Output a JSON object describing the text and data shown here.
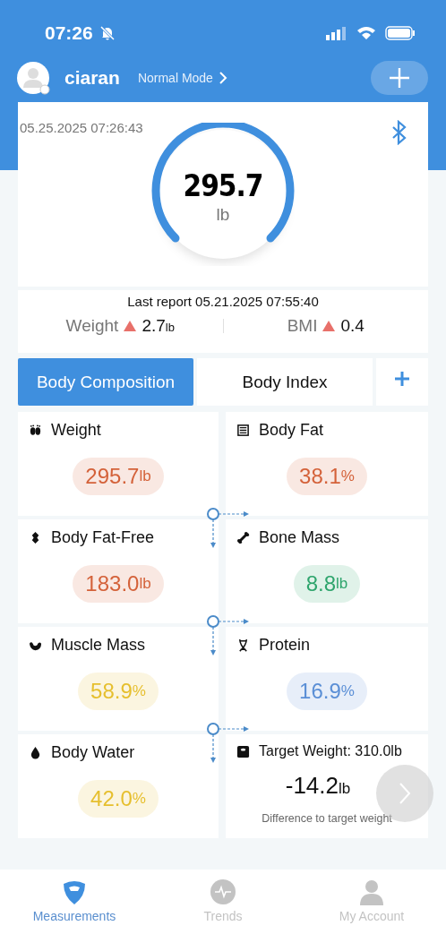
{
  "status_bar": {
    "time": "07:26"
  },
  "profile": {
    "name": "ciaran",
    "mode": "Normal Mode"
  },
  "reading": {
    "timestamp": "05.25.2025 07:26:43",
    "value": "295.7",
    "unit": "lb"
  },
  "report": {
    "title": "Last report 05.21.2025 07:55:40",
    "changes": [
      {
        "label": "Weight",
        "increased": true,
        "value": "2.7",
        "unit": "lb"
      },
      {
        "label": "BMI",
        "increased": true,
        "value": "0.4"
      }
    ]
  },
  "tabs": [
    {
      "label": "Body Composition",
      "selected": true
    },
    {
      "label": "Body Index",
      "selected": false
    }
  ],
  "metrics": [
    {
      "kind": "metric",
      "label": "Weight",
      "value": "295.7",
      "unit": "lb",
      "color": "#d4623a"
    },
    {
      "kind": "metric",
      "label": "Body Fat",
      "value": "38.1",
      "unit": "%",
      "color": "#d4623a"
    },
    {
      "kind": "metric",
      "label": "Body Fat-Free",
      "value": "183.0",
      "unit": "lb",
      "color": "#d4623a"
    },
    {
      "kind": "metric",
      "label": "Bone Mass",
      "value": "8.8",
      "unit": "lb",
      "color": "#2fa56d"
    },
    {
      "kind": "metric",
      "label": "Muscle Mass",
      "value": "58.9",
      "unit": "%",
      "color": "#e6bf2e"
    },
    {
      "kind": "metric",
      "label": "Protein",
      "value": "16.9",
      "unit": "%",
      "color": "#5b8fd6"
    },
    {
      "kind": "metric",
      "label": "Body Water",
      "value": "42.0",
      "unit": "%",
      "color": "#e6bf2e"
    },
    {
      "kind": "target",
      "label": "Target Weight: 310.0lb",
      "value": "-14.2",
      "unit": "lb",
      "caption": "Difference to target weight"
    }
  ],
  "nav": [
    {
      "label": "Measurements",
      "selected": true
    },
    {
      "label": "Trends",
      "selected": false
    },
    {
      "label": "My Account",
      "selected": false
    }
  ]
}
